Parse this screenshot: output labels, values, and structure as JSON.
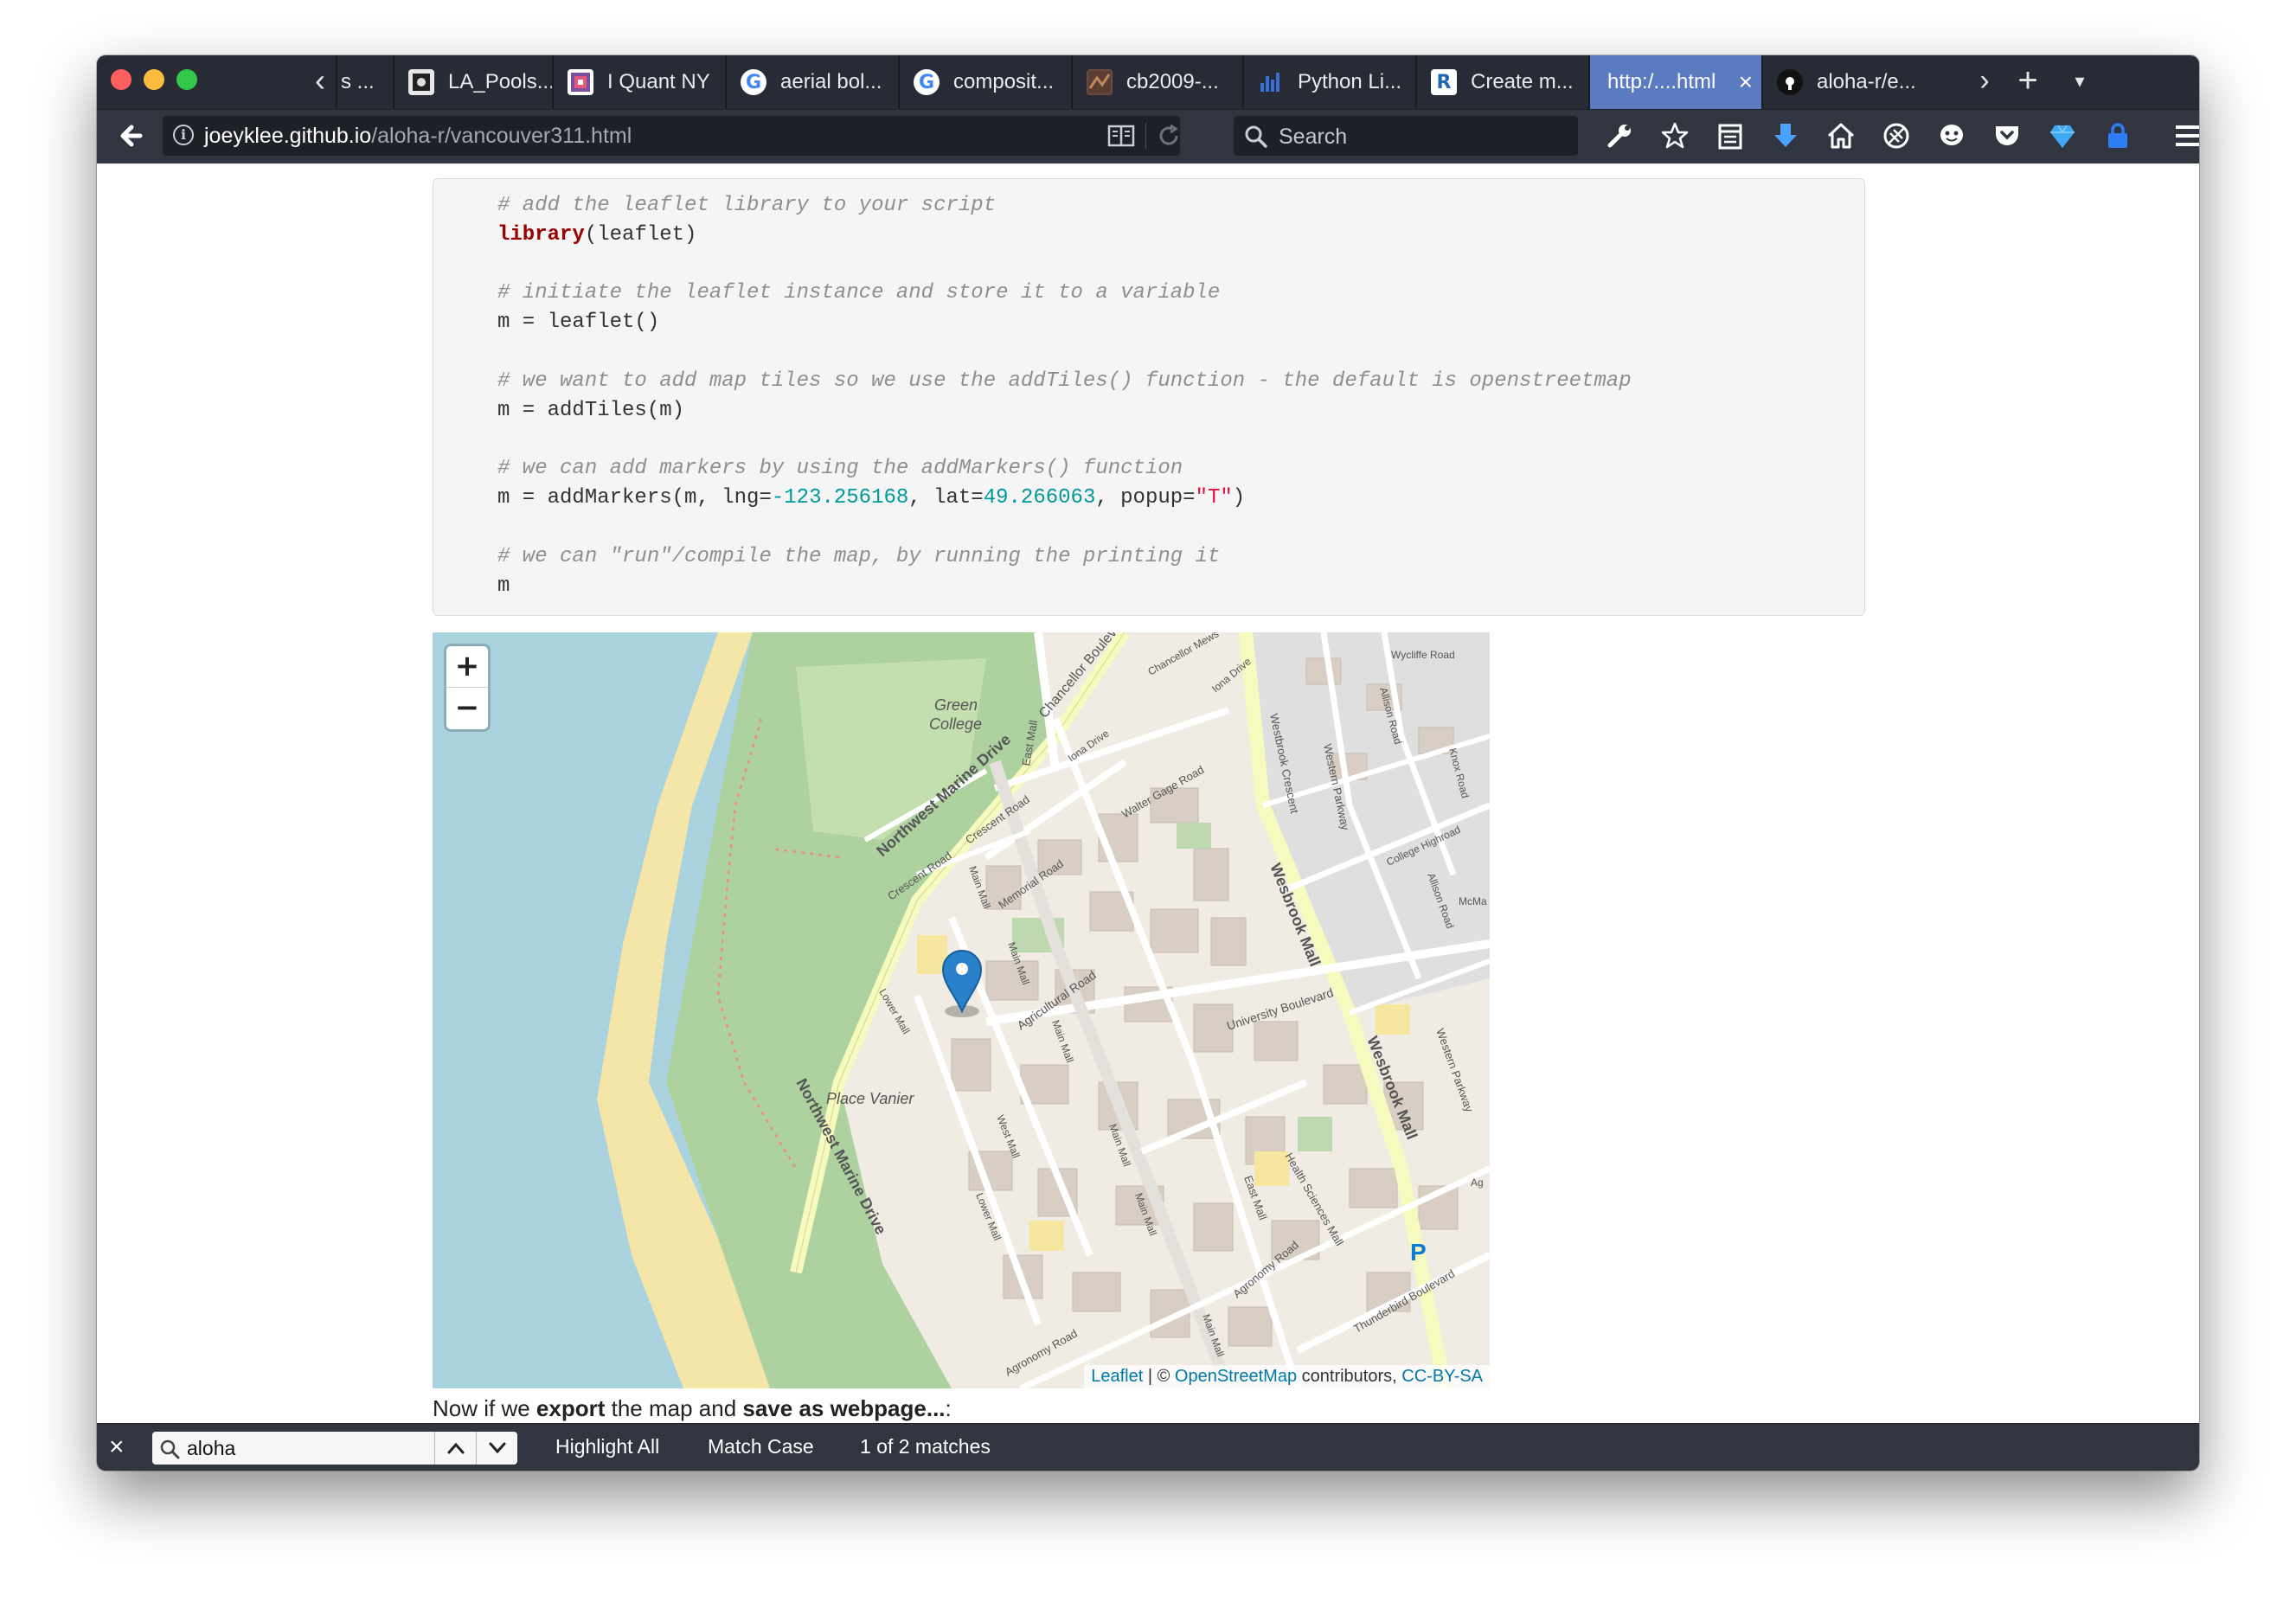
{
  "colors": {
    "titlebar": "#272b35",
    "navbar": "#31353f",
    "active_tab": "#5a7bbf",
    "map_water": "#aad3df",
    "map_park": "#cde5b2",
    "map_urban": "#f1eee8",
    "marker": "#2a81cb"
  },
  "tabs": [
    {
      "label": "s ...",
      "icon": "partial-tab-icon"
    },
    {
      "label": "LA_Pools...",
      "icon": "pool-image-icon"
    },
    {
      "label": "I Quant NY",
      "icon": "iquantny-icon"
    },
    {
      "label": "aerial bol...",
      "icon": "google-icon"
    },
    {
      "label": "composit...",
      "icon": "google-icon"
    },
    {
      "label": "cb2009-...",
      "icon": "map-thumbnail-icon"
    },
    {
      "label": "Python Li...",
      "icon": "chart-icon"
    },
    {
      "label": "Create m...",
      "icon": "r-logo-icon"
    },
    {
      "label": "http:/....html",
      "icon": "none",
      "active": true
    },
    {
      "label": "aloha-r/e...",
      "icon": "github-icon"
    }
  ],
  "tab_controls": {
    "scroll_left": "‹",
    "scroll_right": "›",
    "new_tab": "+",
    "list_all": "▾"
  },
  "address_bar": {
    "domain": "joeyklee.github.io",
    "path": "/aloha-r/vancouver311.html"
  },
  "search_bar": {
    "placeholder": "Search"
  },
  "toolbar_icons": [
    "wrench-icon",
    "bookmark-star-icon",
    "reading-list-icon",
    "download-icon",
    "home-icon",
    "tracking-icon",
    "emoji-icon",
    "pocket-icon",
    "gem-icon",
    "lock-icon",
    "menu-icon"
  ],
  "code": {
    "comment1": "# add the leaflet library to your script",
    "lib_kw": "library",
    "lib_arg": "(leaflet)",
    "comment2": "# initiate the leaflet instance and store it to a variable",
    "line_init": "m = leaflet()",
    "comment3": "# we want to add map tiles so we use the addTiles() function - the default is openstreetmap",
    "line_tiles": "m = addTiles(m)",
    "comment4": "# we can add markers by using the addMarkers() function",
    "markers_prefix": "m = addMarkers(m, lng=",
    "markers_lng": "-123.256168",
    "markers_mid": ", lat=",
    "markers_lat": "49.266063",
    "markers_mid2": ", popup=",
    "markers_popup": "\"T\"",
    "markers_suffix": ")",
    "comment5": "# we can \"run\"/compile the map, by running the printing it",
    "line_print": "m"
  },
  "map": {
    "zoom_in": "+",
    "zoom_out": "−",
    "attribution": {
      "leaflet": "Leaflet",
      "sep": " | © ",
      "osm": "OpenStreetMap",
      "contrib": " contributors, ",
      "license": "CC-BY-SA"
    },
    "labels": {
      "green_college_1": "Green",
      "green_college_2": "College",
      "chancellor_blvd": "Chancellor Boulevard",
      "chancellor_mews": "Chancellor Mews",
      "iona_drive_1": "Iona Drive",
      "iona_drive_2": "Iona Drive",
      "wycliffe": "Wycliffe Road",
      "allison_1": "Allison Road",
      "allison_2": "Allison Road",
      "knox": "Knox Road",
      "college_highroad": "College Highroad",
      "mcmaster": "McMa",
      "east_mall_1": "East Mall",
      "east_mall_2": "East Mall",
      "westbrook_cres": "Westbrook Crescent",
      "western_pkwy_1": "Western Parkway",
      "western_pkwy_2": "Western Parkway",
      "walter_gage": "Walter Gage Road",
      "nw_marine_1": "Northwest Marine Drive",
      "nw_marine_2": "Northwest Marine Drive",
      "crescent_1": "Crescent Road",
      "crescent_2": "Crescent Road",
      "main_mall_1": "Main Mall",
      "main_mall_2": "Main Mall",
      "main_mall_3": "Main Mall",
      "main_mall_4": "Main Mall",
      "main_mall_5": "Main Mall",
      "main_mall_6": "Main Mall",
      "memorial": "Memorial Road",
      "wesbrook_1": "Wesbrook Mall",
      "wesbrook_2": "Wesbrook Mall",
      "university_blvd": "University Boulevard",
      "agricultural": "Agricultural Road",
      "lower_mall_1": "Lower Mall",
      "lower_mall_2": "Lower Mall",
      "place_vanier": "Place Vanier",
      "west_mall": "West Mall",
      "health_sciences": "Health Sciences Mall",
      "agronomy_1": "Agronomy Road",
      "agronomy_2": "Agronomy Road",
      "thunderbird": "Thunderbird Boulevard",
      "parking": "P",
      "ag": "Ag"
    }
  },
  "after_code": {
    "t1": "Now if we ",
    "b1": "export",
    "t2": " the map and ",
    "b2": "save as webpage...",
    "t3": ":"
  },
  "find_bar": {
    "close": "×",
    "query": "aloha",
    "highlight_all": "Highlight All",
    "match_case": "Match Case",
    "status": "1 of 2 matches"
  }
}
